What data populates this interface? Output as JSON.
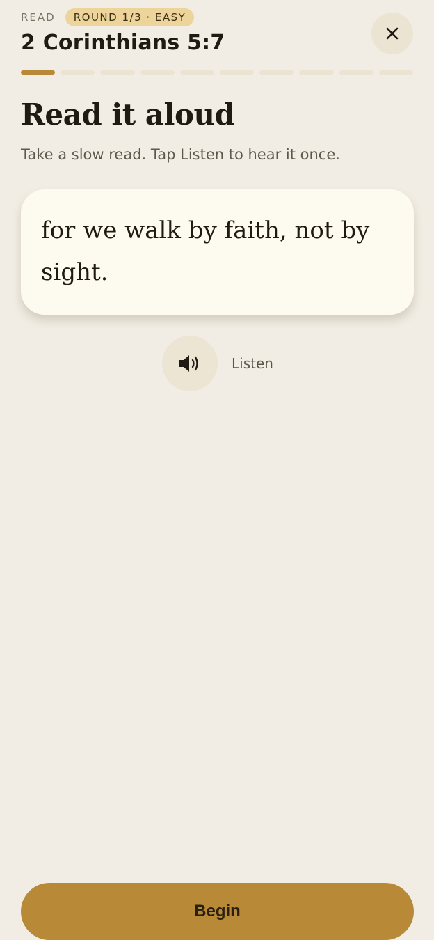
{
  "header": {
    "mode_label": "READ",
    "round_badge": "ROUND 1/3 · EASY",
    "verse_reference": "2 Corinthians 5:7",
    "close_icon": "close-icon"
  },
  "progress": {
    "total_steps": 10,
    "current_step": 1
  },
  "main": {
    "title": "Read it aloud",
    "subtitle": "Take a slow read. Tap Listen to hear it once.",
    "verse_text": "for we walk by faith, not by sight."
  },
  "listen": {
    "icon": "speaker-icon",
    "label": "Listen"
  },
  "footer": {
    "begin_label": "Begin"
  },
  "colors": {
    "background": "#f2ede4",
    "accent": "#b88a38",
    "badge": "#ecd49a",
    "card": "#fdfaef"
  }
}
